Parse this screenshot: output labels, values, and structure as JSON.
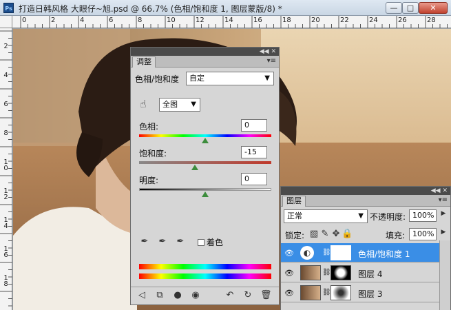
{
  "window": {
    "app_icon": "Ps",
    "title": "打造日韩风格 大眼仔~旭.psd @ 66.7% (色相/饱和度 1, 图层蒙版/8) *",
    "controls": {
      "minimize": "—",
      "maximize": "□",
      "close": "✕"
    }
  },
  "rulers": {
    "top": [
      "0",
      "2",
      "4",
      "6",
      "8",
      "10",
      "12",
      "14",
      "16",
      "18",
      "20",
      "22",
      "24",
      "26",
      "28"
    ],
    "left": [
      "2",
      "4",
      "6",
      "8",
      "1\n0",
      "1\n2",
      "1\n4",
      "1\n6",
      "1\n8"
    ]
  },
  "adjustments": {
    "tab": "调整",
    "type_label": "色相/饱和度",
    "preset": "自定",
    "channel": "全图",
    "hue": {
      "label": "色相:",
      "value": "0"
    },
    "saturation": {
      "label": "饱和度:",
      "value": "-15"
    },
    "lightness": {
      "label": "明度:",
      "value": "0"
    },
    "colorize_label": "着色",
    "colorize_checked": false,
    "icons": {
      "targeted": "hand-adjust-icon",
      "eyedroppers": [
        "eyedropper-icon",
        "eyedropper-plus-icon",
        "eyedropper-minus-icon"
      ],
      "footer": [
        "back-arrow-icon",
        "clip-layer-icon",
        "layer-visibility-icon",
        "eye-preview-icon",
        "previous-state-icon",
        "reset-icon",
        "trash-icon"
      ]
    }
  },
  "layers": {
    "tab": "图层",
    "blend_mode": "正常",
    "opacity_label": "不透明度:",
    "opacity_value": "100%",
    "lock_label": "锁定:",
    "fill_label": "填充:",
    "fill_value": "100%",
    "items": [
      {
        "name": "色相/饱和度 1",
        "selected": true
      },
      {
        "name": "图层 4",
        "selected": false
      },
      {
        "name": "图层 3",
        "selected": false
      }
    ]
  },
  "colors": {
    "selection": "#3a8ee6",
    "panel_bg": "#d6d6d6",
    "saturation_bar": "#c0392b"
  }
}
